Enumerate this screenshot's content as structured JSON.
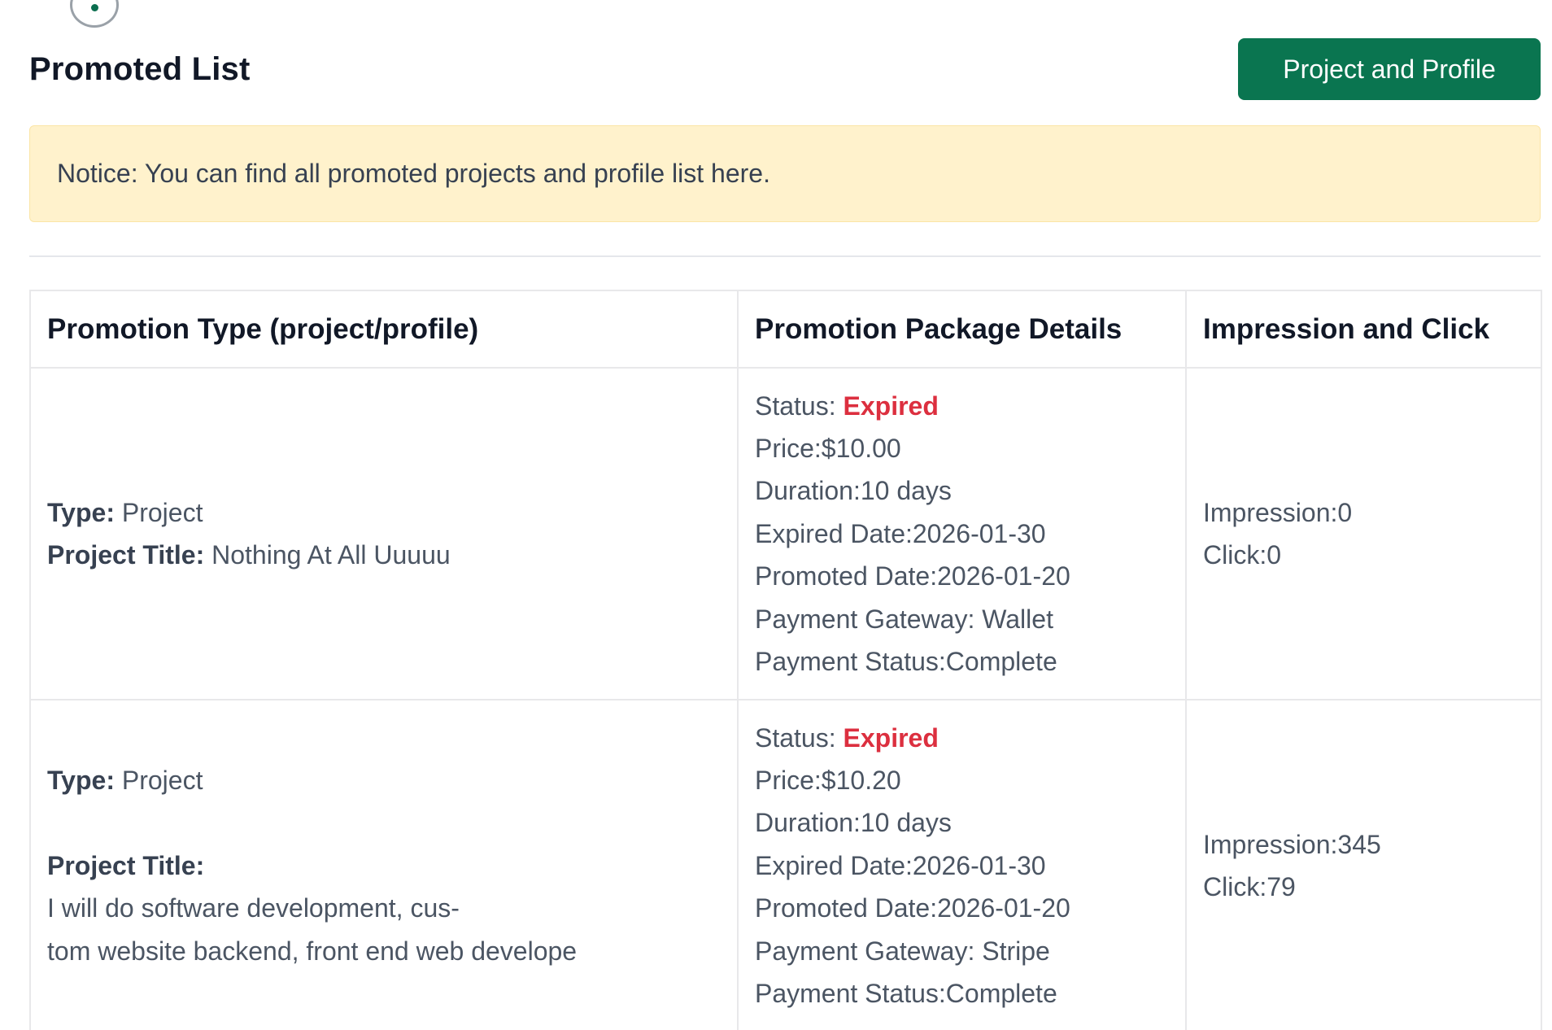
{
  "header": {
    "title": "Promoted List",
    "button_label": "Project and Profile"
  },
  "notice": {
    "text": "Notice: You can find all promoted projects and profile list here."
  },
  "colors": {
    "primary_button": "#0a7550",
    "notice_background": "#fff2cc",
    "expired_status": "#dc2f3f"
  },
  "table": {
    "columns": [
      "Promotion Type (project/profile)",
      "Promotion Package Details",
      "Impression and Click"
    ],
    "rows": [
      {
        "type_label": "Type:",
        "type_value": "Project",
        "title_label": "Project Title:",
        "title_value": "Nothing At All Uuuuu",
        "status_label": "Status:",
        "status_value": "Expired",
        "price": "Price:$10.00",
        "duration": "Duration:10 days",
        "expired_date": "Expired Date:2026-01-30",
        "promoted_date": "Promoted Date:2026-01-20",
        "payment_gateway": "Payment Gateway: Wallet",
        "payment_status": "Payment Status:Complete",
        "impression": "Impression:0",
        "click": "Click:0"
      },
      {
        "type_label": "Type:",
        "type_value": "Project",
        "title_label": "Project Title:",
        "title_value": "I will do software development, cus-\ntom website backend, front end web develope",
        "status_label": "Status:",
        "status_value": "Expired",
        "price": "Price:$10.20",
        "duration": "Duration:10 days",
        "expired_date": "Expired Date:2026-01-30",
        "promoted_date": "Promoted Date:2026-01-20",
        "payment_gateway": "Payment Gateway: Stripe",
        "payment_status": "Payment Status:Complete",
        "impression": "Impression:345",
        "click": "Click:79"
      }
    ]
  }
}
